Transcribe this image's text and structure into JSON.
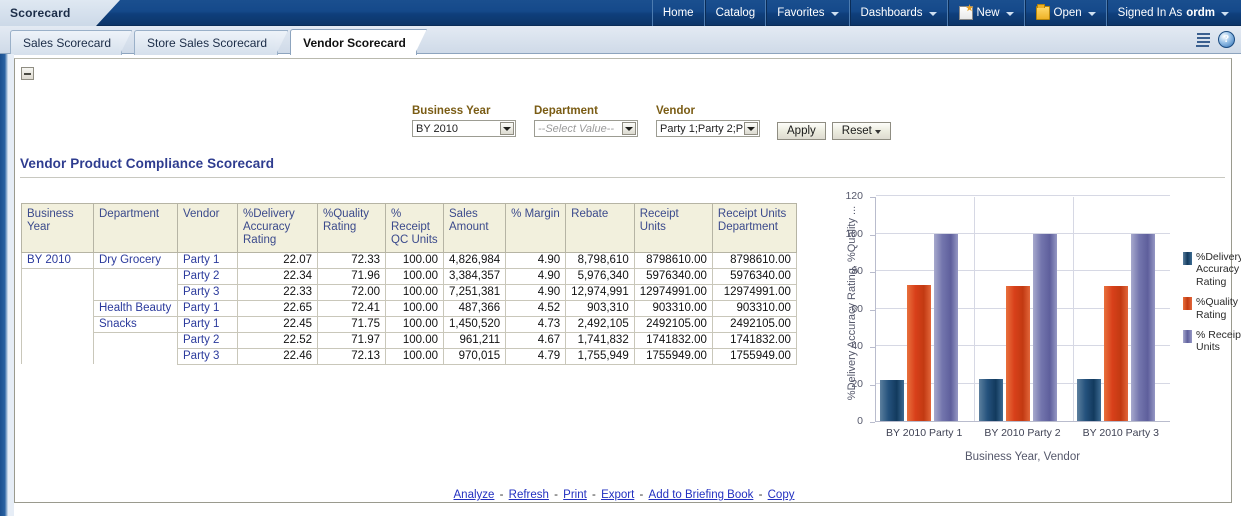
{
  "topbar": {
    "app_title": "Scorecard",
    "nav": [
      {
        "label": "Home",
        "icon": null,
        "caret": false
      },
      {
        "label": "Catalog",
        "icon": null,
        "caret": false
      },
      {
        "label": "Favorites",
        "icon": null,
        "caret": true
      },
      {
        "label": "Dashboards",
        "icon": null,
        "caret": true
      },
      {
        "label": "New",
        "icon": "new-page-icon",
        "caret": true
      },
      {
        "label": "Open",
        "icon": "folder-icon",
        "caret": true
      }
    ],
    "signed_in_label": "Signed In As",
    "user": "ordm"
  },
  "tabstrip": {
    "tabs": [
      {
        "label": "Sales Scorecard",
        "active": false
      },
      {
        "label": "Store Sales Scorecard",
        "active": false
      },
      {
        "label": "Vendor Scorecard",
        "active": true
      }
    ],
    "icons": [
      {
        "name": "page-options-icon",
        "glyph": ""
      },
      {
        "name": "help-icon",
        "glyph": "?"
      }
    ]
  },
  "prompts": [
    {
      "label": "Business Year",
      "value": "BY 2010",
      "placeholder": false,
      "name": "business-year-select"
    },
    {
      "label": "Department",
      "value": "--Select Value--",
      "placeholder": true,
      "name": "department-select"
    },
    {
      "label": "Vendor",
      "value": "Party 1;Party 2;P",
      "placeholder": false,
      "name": "vendor-select"
    }
  ],
  "buttons": {
    "apply": "Apply",
    "reset": "Reset"
  },
  "report": {
    "title": "Vendor Product Compliance Scorecard",
    "columns": [
      "Business Year",
      "Department",
      "Vendor",
      "%Delivery Accuracy Rating",
      "%Quality Rating",
      "% Receipt QC Units",
      "Sales Amount",
      "% Margin",
      "Rebate",
      "Receipt Units",
      "Receipt Units Department"
    ],
    "rows": [
      {
        "business_year": "BY 2010",
        "department": "Dry Grocery",
        "vendor": "Party 1",
        "delivery_accuracy": "22.07",
        "quality_rating": "72.33",
        "receipt_qc_units": "100.00",
        "sales_amount": "4,826,984",
        "margin": "4.90",
        "rebate": "8,798,610",
        "receipt_units": "8798610.00",
        "receipt_units_department": "8798610.00"
      },
      {
        "business_year": "",
        "department": "",
        "vendor": "Party 2",
        "delivery_accuracy": "22.34",
        "quality_rating": "71.96",
        "receipt_qc_units": "100.00",
        "sales_amount": "3,384,357",
        "margin": "4.90",
        "rebate": "5,976,340",
        "receipt_units": "5976340.00",
        "receipt_units_department": "5976340.00"
      },
      {
        "business_year": "",
        "department": "",
        "vendor": "Party 3",
        "delivery_accuracy": "22.33",
        "quality_rating": "72.00",
        "receipt_qc_units": "100.00",
        "sales_amount": "7,251,381",
        "margin": "4.90",
        "rebate": "12,974,991",
        "receipt_units": "12974991.00",
        "receipt_units_department": "12974991.00"
      },
      {
        "business_year": "",
        "department": "Health Beauty",
        "vendor": "Party 1",
        "delivery_accuracy": "22.65",
        "quality_rating": "72.41",
        "receipt_qc_units": "100.00",
        "sales_amount": "487,366",
        "margin": "4.52",
        "rebate": "903,310",
        "receipt_units": "903310.00",
        "receipt_units_department": "903310.00"
      },
      {
        "business_year": "",
        "department": "Snacks",
        "vendor": "Party 1",
        "delivery_accuracy": "22.45",
        "quality_rating": "71.75",
        "receipt_qc_units": "100.00",
        "sales_amount": "1,450,520",
        "margin": "4.73",
        "rebate": "2,492,105",
        "receipt_units": "2492105.00",
        "receipt_units_department": "2492105.00"
      },
      {
        "business_year": "",
        "department": "",
        "vendor": "Party 2",
        "delivery_accuracy": "22.52",
        "quality_rating": "71.97",
        "receipt_qc_units": "100.00",
        "sales_amount": "961,211",
        "margin": "4.67",
        "rebate": "1,741,832",
        "receipt_units": "1741832.00",
        "receipt_units_department": "1741832.00"
      },
      {
        "business_year": "",
        "department": "",
        "vendor": "Party 3",
        "delivery_accuracy": "22.46",
        "quality_rating": "72.13",
        "receipt_qc_units": "100.00",
        "sales_amount": "970,015",
        "margin": "4.79",
        "rebate": "1,755,949",
        "receipt_units": "1755949.00",
        "receipt_units_department": "1755949.00"
      }
    ]
  },
  "chart_data": {
    "type": "bar",
    "title": "",
    "categories": [
      "BY 2010 Party 1",
      "BY 2010 Party 2",
      "BY 2010 Party 3"
    ],
    "series": [
      {
        "name": "%Delivery Accuracy Rating",
        "values": [
          22.07,
          22.34,
          22.33
        ],
        "color": "#123a5e"
      },
      {
        "name": "%Quality Rating",
        "values": [
          72.33,
          71.96,
          72.0
        ],
        "color": "#c23a12"
      },
      {
        "name": "% Receipt QC Units",
        "values": [
          100.0,
          100.0,
          100.0
        ],
        "color": "#5e5f9c"
      }
    ],
    "xlabel": "Business Year, Vendor",
    "ylabel": "%Delivery Accuracy Rating, %Quality ...",
    "ylim": [
      0,
      120
    ],
    "yticks": [
      0,
      20,
      40,
      60,
      80,
      100,
      120
    ],
    "grid": true,
    "legend_position": "right"
  },
  "footer": {
    "links": [
      "Analyze",
      "Refresh",
      "Print",
      "Export",
      "Add to Briefing Book",
      "Copy"
    ],
    "separator": "-"
  }
}
